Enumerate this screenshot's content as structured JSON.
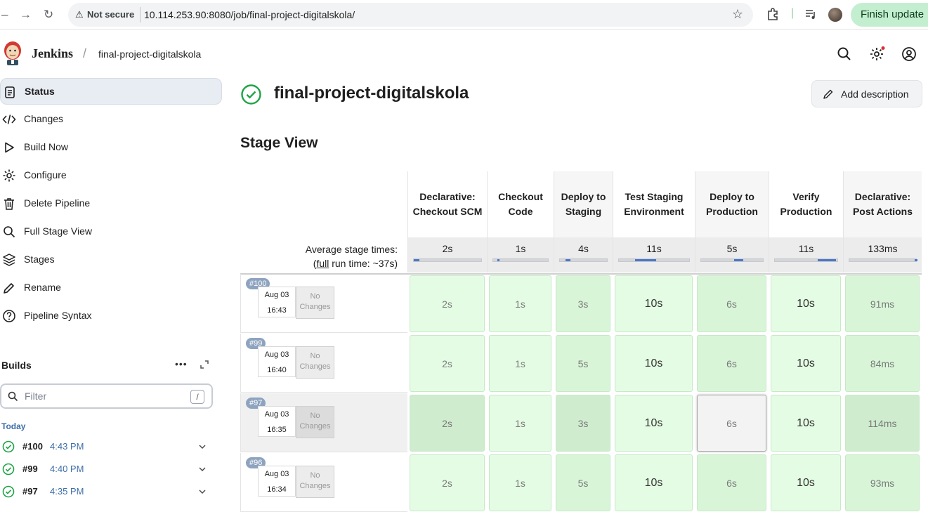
{
  "browser": {
    "security_label": "Not secure",
    "url": "10.114.253.90:8080/job/final-project-digitalskola/",
    "finish_update": "Finish update"
  },
  "header": {
    "brand": "Jenkins",
    "breadcrumb": "final-project-digitalskola",
    "breadcrumb_sep": "/"
  },
  "sidebar": {
    "items": [
      {
        "label": "Status",
        "icon": "clipboard-icon"
      },
      {
        "label": "Changes",
        "icon": "code-icon"
      },
      {
        "label": "Build Now",
        "icon": "play-icon"
      },
      {
        "label": "Configure",
        "icon": "gear-icon"
      },
      {
        "label": "Delete Pipeline",
        "icon": "trash-icon"
      },
      {
        "label": "Full Stage View",
        "icon": "search-icon"
      },
      {
        "label": "Stages",
        "icon": "layers-icon"
      },
      {
        "label": "Rename",
        "icon": "pencil-icon"
      },
      {
        "label": "Pipeline Syntax",
        "icon": "help-icon"
      }
    ],
    "builds_title": "Builds",
    "builds_more": "•••",
    "filter_placeholder": "Filter",
    "filter_key": "/",
    "today": "Today",
    "builds": [
      {
        "num": "#100",
        "time": "4:43 PM"
      },
      {
        "num": "#99",
        "time": "4:40 PM"
      },
      {
        "num": "#97",
        "time": "4:35 PM"
      }
    ]
  },
  "main": {
    "title": "final-project-digitalskola",
    "add_description": "Add description",
    "stage_view_title": "Stage View",
    "avg_label_1": "Average stage times:",
    "avg_label_2_pre": "(",
    "avg_label_2_link": "full",
    "avg_label_2_post": " run time: ~37s)"
  },
  "stages": [
    {
      "name": "Declarative: Checkout SCM",
      "avg": "2s",
      "fill_start": 0.0,
      "fill_width": 0.08
    },
    {
      "name": "Checkout Code",
      "avg": "1s",
      "fill_start": 0.08,
      "fill_width": 0.04
    },
    {
      "name": "Deploy to Staging",
      "avg": "4s",
      "fill_start": 0.12,
      "fill_width": 0.11
    },
    {
      "name": "Test Staging Environment",
      "avg": "11s",
      "fill_start": 0.23,
      "fill_width": 0.3
    },
    {
      "name": "Deploy to Production",
      "avg": "5s",
      "fill_start": 0.53,
      "fill_width": 0.15
    },
    {
      "name": "Verify Production",
      "avg": "11s",
      "fill_start": 0.68,
      "fill_width": 0.3
    },
    {
      "name": "Declarative: Post Actions",
      "avg": "133ms",
      "fill_start": 0.98,
      "fill_width": 0.02
    }
  ],
  "runs": [
    {
      "badge": "#100",
      "date": "Aug 03",
      "time": "16:43",
      "changes": "No Changes",
      "durations": [
        "2s",
        "1s",
        "3s",
        "10s",
        "6s",
        "10s",
        "91ms"
      ]
    },
    {
      "badge": "#99",
      "date": "Aug 03",
      "time": "16:40",
      "changes": "No Changes",
      "durations": [
        "2s",
        "1s",
        "5s",
        "10s",
        "6s",
        "10s",
        "84ms"
      ]
    },
    {
      "badge": "#97",
      "date": "Aug 03",
      "time": "16:35",
      "changes": "No Changes",
      "durations": [
        "2s",
        "1s",
        "3s",
        "10s",
        "6s",
        "10s",
        "114ms"
      ]
    },
    {
      "badge": "#96",
      "date": "Aug 03",
      "time": "16:34",
      "changes": "No Changes",
      "durations": [
        "2s",
        "1s",
        "5s",
        "10s",
        "6s",
        "10s",
        "93ms"
      ]
    }
  ],
  "colors": {
    "success_green": "#1ea446",
    "cell_green": "#e4fce4",
    "accent_blue": "#4a78c8",
    "finish_bg": "#c4eed0"
  }
}
